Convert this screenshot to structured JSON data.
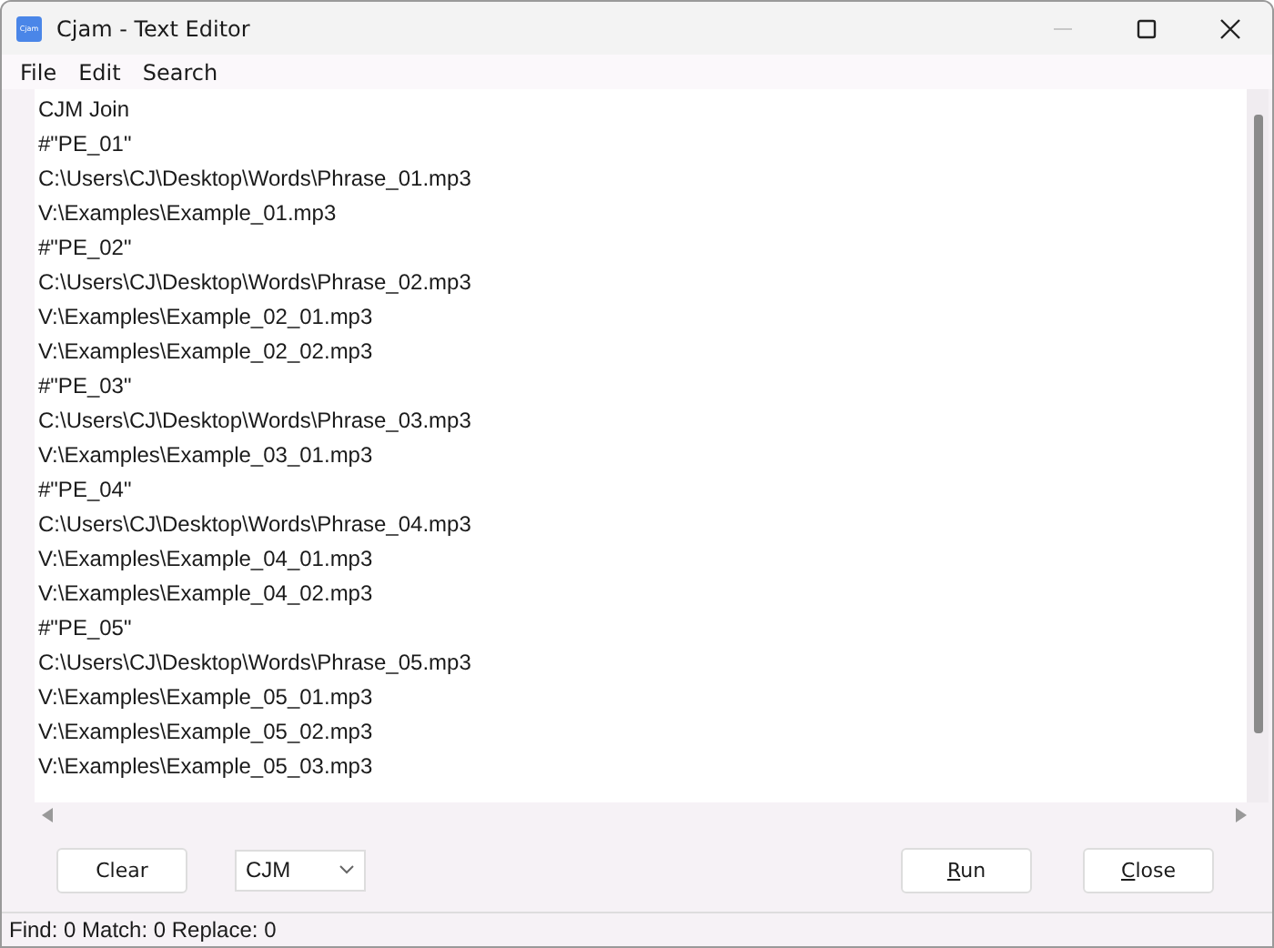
{
  "window": {
    "title": "Cjam - Text Editor",
    "app_icon_text": "Cjam",
    "minimize_disabled": true
  },
  "menu": [
    "File",
    "Edit",
    "Search"
  ],
  "editor_lines": [
    "CJM Join",
    "#\"PE_01\"",
    "C:\\Users\\CJ\\Desktop\\Words\\Phrase_01.mp3",
    "V:\\Examples\\Example_01.mp3",
    "#\"PE_02\"",
    "C:\\Users\\CJ\\Desktop\\Words\\Phrase_02.mp3",
    "V:\\Examples\\Example_02_01.mp3",
    "V:\\Examples\\Example_02_02.mp3",
    "#\"PE_03\"",
    "C:\\Users\\CJ\\Desktop\\Words\\Phrase_03.mp3",
    "V:\\Examples\\Example_03_01.mp3",
    "#\"PE_04\"",
    "C:\\Users\\CJ\\Desktop\\Words\\Phrase_04.mp3",
    "V:\\Examples\\Example_04_01.mp3",
    "V:\\Examples\\Example_04_02.mp3",
    "#\"PE_05\"",
    "C:\\Users\\CJ\\Desktop\\Words\\Phrase_05.mp3",
    "V:\\Examples\\Example_05_01.mp3",
    "V:\\Examples\\Example_05_02.mp3",
    "V:\\Examples\\Example_05_03.mp3"
  ],
  "clear_button": {
    "label": "Clear"
  },
  "mode_dropdown": {
    "value": "CJM"
  },
  "run_button": {
    "label": "Run",
    "first_letter_underlined": true
  },
  "close_button": {
    "label": "Close",
    "first_letter_underlined": true
  },
  "status_bar": "Find: 0 Match: 0 Replace: 0"
}
